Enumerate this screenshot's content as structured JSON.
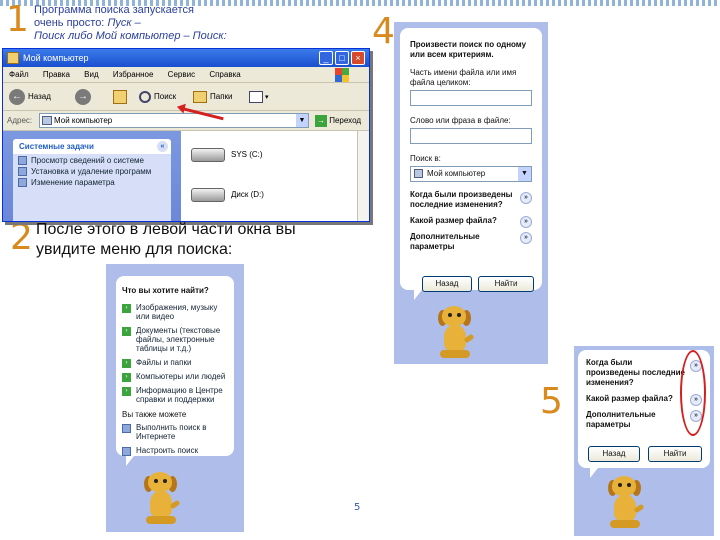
{
  "steps": {
    "one": "1",
    "two": "2",
    "four": "4",
    "five": "5"
  },
  "caption_top": {
    "line1": "Программа поиска запускается",
    "line2": "очень просто:",
    "line2_it": "Пуск –",
    "line3": "Поиск либо Мой компьютер – Поиск:"
  },
  "caption_big": "После этого в левой части окна вы увидите меню для поиска:",
  "slide_number": "5",
  "explorer": {
    "title": "Мой компьютер",
    "menu": [
      "Файл",
      "Правка",
      "Вид",
      "Избранное",
      "Сервис",
      "Справка"
    ],
    "back_label": "Назад",
    "search_label": "Поиск",
    "folders_label": "Папки",
    "address_label": "Адрес:",
    "address_value": "Мой компьютер",
    "go_label": "Переход",
    "tasks_title": "Системные задачи",
    "tasks": [
      "Просмотр сведений о системе",
      "Установка и удаление программ",
      "Изменение параметра"
    ],
    "drives": [
      "SYS (C:)",
      "Диск (D:)"
    ]
  },
  "panel2": {
    "heading": "Что вы хотите найти?",
    "items": [
      "Изображения, музыку или видео",
      "Документы (текстовые файлы, электронные таблицы и т.д.)",
      "Файлы и папки",
      "Компьютеры или людей",
      "Информацию в Центре справки и поддержки"
    ],
    "subheading": "Вы также можете",
    "links": [
      "Выполнить поиск в Интернете",
      "Настроить поиск"
    ]
  },
  "panel4": {
    "heading": "Произвести поиск по одному или всем критериям.",
    "name_label": "Часть имени файла или имя файла целиком:",
    "phrase_label": "Слово или фраза в файле:",
    "lookin_label": "Поиск в:",
    "lookin_value": "Мой компьютер",
    "options": [
      "Когда были произведены последние изменения?",
      "Какой размер файла?",
      "Дополнительные параметры"
    ],
    "back_button": "Назад",
    "find_button": "Найти"
  },
  "panel5": {
    "options": [
      "Когда были произведены последние изменения?",
      "Какой размер файла?",
      "Дополнительные параметры"
    ],
    "back_button": "Назад",
    "find_button": "Найти"
  },
  "colors": {
    "accent": "#d98a1e",
    "link": "#2a3f9e",
    "highlight": "#d52020",
    "panel": "#aebdea"
  }
}
